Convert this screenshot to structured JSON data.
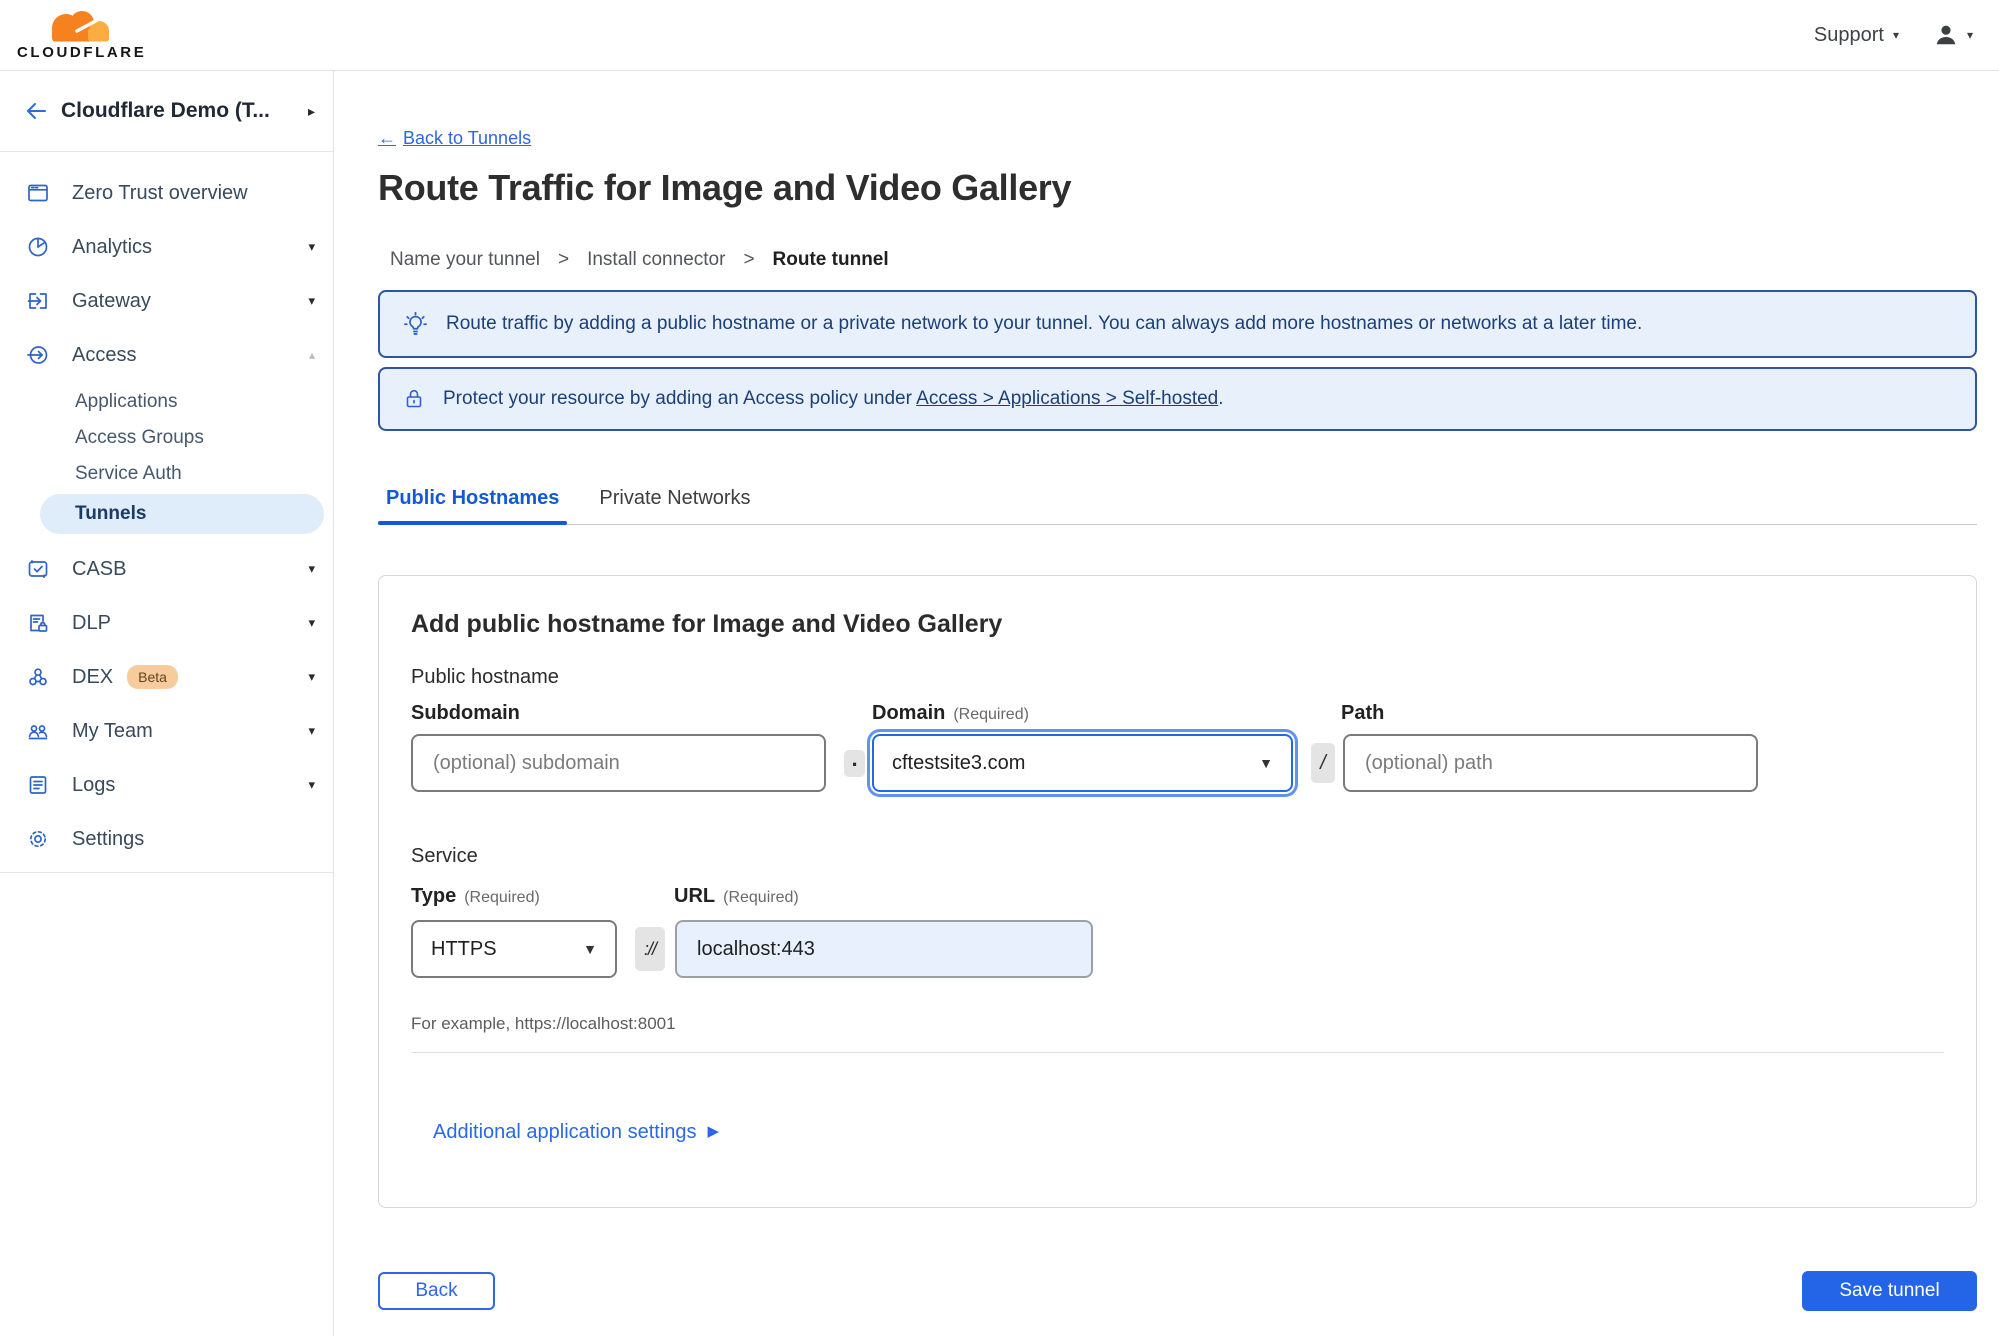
{
  "colors": {
    "accent_blue": "#2465e8",
    "link_blue": "#2c67e0",
    "tab_active_blue": "#1259d6",
    "banner_bg": "#e8f1fb",
    "banner_border": "#2e55a0",
    "banner_text": "#1b3f77",
    "selected_pill_bg": "#dfecf9",
    "selected_pill_text": "#1b3a66",
    "sidebar_icon_blue": "#2f64c7",
    "url_autofill_bg": "#e8f0fe",
    "beta_badge_bg": "#f8cb9c",
    "beta_badge_text": "#62441f",
    "logo_orange": "#f6821f",
    "logo_light_orange": "#fbad41"
  },
  "icons": {
    "back_arrow": "←",
    "caret_right": "▸",
    "chevron_down": "▾",
    "chevron_up": "▴",
    "select_caret": "▼",
    "breadcrumb_sep": ">",
    "details_arrow": "▶"
  },
  "topbar": {
    "logo_text": "CLOUDFLARE",
    "support_label": "Support"
  },
  "sidebar": {
    "account_name": "Cloudflare Demo (T...",
    "items": [
      {
        "label": "Zero Trust overview"
      },
      {
        "label": "Analytics"
      },
      {
        "label": "Gateway"
      },
      {
        "label": "Access"
      },
      {
        "label": "CASB"
      },
      {
        "label": "DLP"
      },
      {
        "label": "DEX",
        "badge": "Beta"
      },
      {
        "label": "My Team"
      },
      {
        "label": "Logs"
      },
      {
        "label": "Settings"
      }
    ],
    "access_subitems": [
      {
        "label": "Applications"
      },
      {
        "label": "Access Groups"
      },
      {
        "label": "Service Auth"
      },
      {
        "label": "Tunnels",
        "selected": true
      }
    ]
  },
  "main": {
    "back_link": "Back to Tunnels",
    "title": "Route Traffic for Image and Video Gallery",
    "breadcrumb": {
      "step1": "Name your tunnel",
      "step2": "Install connector",
      "step3": "Route tunnel"
    },
    "banner_tip": "Route traffic by adding a public hostname or a private network to your tunnel. You can always add more hostnames or networks at a later time.",
    "banner_protect_prefix": "Protect your resource by adding an Access policy under",
    "banner_protect_link": "Access > Applications > Self-hosted",
    "banner_protect_suffix": ".",
    "tabs": {
      "public": "Public Hostnames",
      "private": "Private Networks"
    },
    "form": {
      "heading": "Add public hostname for Image and Video Gallery",
      "public_hostname_label": "Public hostname",
      "subdomain_label": "Subdomain",
      "domain_label": "Domain",
      "path_label": "Path",
      "required_hint": "(Required)",
      "subdomain_placeholder": "(optional) subdomain",
      "domain_value": "cftestsite3.com",
      "path_placeholder": "(optional) path",
      "dot_separator": ".",
      "slash_separator": "/",
      "service_label": "Service",
      "type_label": "Type",
      "url_label": "URL",
      "type_value": "HTTPS",
      "scheme_separator": "://",
      "url_value": "localhost:443",
      "example_hint": "For example, https://localhost:8001",
      "additional_settings": "Additional application settings"
    },
    "footer": {
      "back": "Back",
      "save": "Save tunnel"
    }
  }
}
